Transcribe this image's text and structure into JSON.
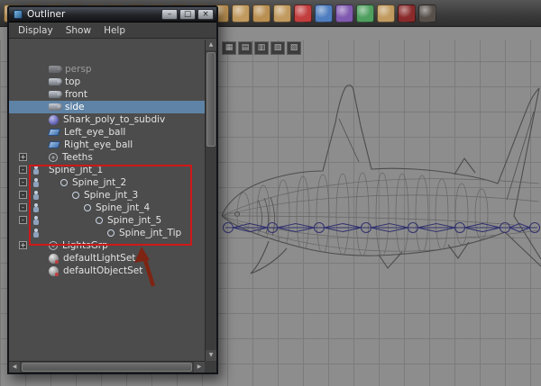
{
  "colors": {
    "selection": "#5f83a6",
    "annotation_red": "#d01818",
    "arrow": "#7e2413",
    "joint_chain": "#2f2f6e",
    "viewport_bg": "#8d8d8d"
  },
  "shelf": {
    "icons": [
      {
        "name": "shelf-icon",
        "color": "#c09a5e"
      },
      {
        "name": "shelf-icon",
        "color": "#b98f52"
      },
      {
        "name": "shelf-icon",
        "color": "#c09a5e"
      },
      {
        "name": "shelf-icon",
        "color": "#b98f52"
      },
      {
        "name": "shelf-icon",
        "color": "#c09a5e"
      },
      {
        "name": "shelf-icon",
        "color": "#c09a5e"
      },
      {
        "name": "shelf-icon",
        "color": "#b98f52"
      },
      {
        "name": "shelf-icon",
        "color": "#c09a5e"
      },
      {
        "name": "shelf-icon",
        "color": "#b98f52"
      },
      {
        "name": "shelf-icon",
        "color": "#c09a5e"
      },
      {
        "name": "shelf-icon",
        "color": "#b98f52"
      },
      {
        "name": "shelf-icon",
        "color": "#c09a5e"
      },
      {
        "name": "shelf-icon",
        "color": "#b98f52"
      },
      {
        "name": "shelf-icon",
        "color": "#c09a5e"
      },
      {
        "name": "shelf-icon",
        "color": "#c23d3d"
      },
      {
        "name": "shelf-icon",
        "color": "#4f7ec0"
      },
      {
        "name": "shelf-icon",
        "color": "#8059b0"
      },
      {
        "name": "shelf-icon",
        "color": "#4fa05f"
      },
      {
        "name": "shelf-icon",
        "color": "#c09a5e"
      },
      {
        "name": "shelf-icon",
        "color": "#8a2a2a"
      },
      {
        "name": "shelf-icon",
        "color": "#57504a"
      }
    ]
  },
  "viewport_toolbar": {
    "icons": [
      {
        "name": "snap-grid-icon",
        "glyph": "▦"
      },
      {
        "name": "snap-curve-icon",
        "glyph": "▤"
      },
      {
        "name": "snap-point-icon",
        "glyph": "▥"
      },
      {
        "name": "snap-view-icon",
        "glyph": "▧"
      },
      {
        "name": "snap-surface-icon",
        "glyph": "▨"
      }
    ]
  },
  "outliner": {
    "title": "Outliner",
    "window_controls": {
      "minimize": "–",
      "maximize": "□",
      "close": "×"
    },
    "menus": [
      "Display",
      "Show",
      "Help"
    ],
    "scrollbar": {
      "up": "▲",
      "down": "▼",
      "left": "◀",
      "right": "▶"
    },
    "items": [
      {
        "label": "persp",
        "icon": "camera-icon",
        "indent": 1,
        "muted": true
      },
      {
        "label": "top",
        "icon": "camera-icon",
        "indent": 1
      },
      {
        "label": "front",
        "icon": "camera-icon",
        "indent": 1
      },
      {
        "label": "side",
        "icon": "camera-icon",
        "indent": 1,
        "selected": true
      },
      {
        "label": "Shark_poly_to_subdiv",
        "icon": "subdiv-icon",
        "indent": 1
      },
      {
        "label": "Left_eye_ball",
        "icon": "surface-icon",
        "indent": 1
      },
      {
        "label": "Right_eye_ball",
        "icon": "surface-icon",
        "indent": 1
      },
      {
        "label": "Teeths",
        "icon": "transform-icon",
        "indent": 1,
        "toggle": "+"
      },
      {
        "label": "Spine_jnt_1",
        "icon": "joint-icon",
        "indent": 1,
        "toggle": "-",
        "in_highlight": true
      },
      {
        "label": "Spine_jnt_2",
        "icon": "joint-icon",
        "indent": 2,
        "toggle": "-",
        "in_highlight": true
      },
      {
        "label": "Spine_jnt_3",
        "icon": "joint-icon",
        "indent": 3,
        "toggle": "-",
        "in_highlight": true
      },
      {
        "label": "Spine_jnt_4",
        "icon": "joint-icon",
        "indent": 4,
        "toggle": "-",
        "in_highlight": true
      },
      {
        "label": "Spine_jnt_5",
        "icon": "joint-icon",
        "indent": 5,
        "toggle": "-",
        "in_highlight": true
      },
      {
        "label": "Spine_jnt_Tip",
        "icon": "joint-icon",
        "indent": 6,
        "in_highlight": true
      },
      {
        "label": "LightsGrp",
        "icon": "transform-icon",
        "indent": 1,
        "toggle": "+"
      },
      {
        "label": "defaultLightSet",
        "icon": "set-icon",
        "indent": 1
      },
      {
        "label": "defaultObjectSet",
        "icon": "set-icon",
        "indent": 1
      }
    ]
  }
}
